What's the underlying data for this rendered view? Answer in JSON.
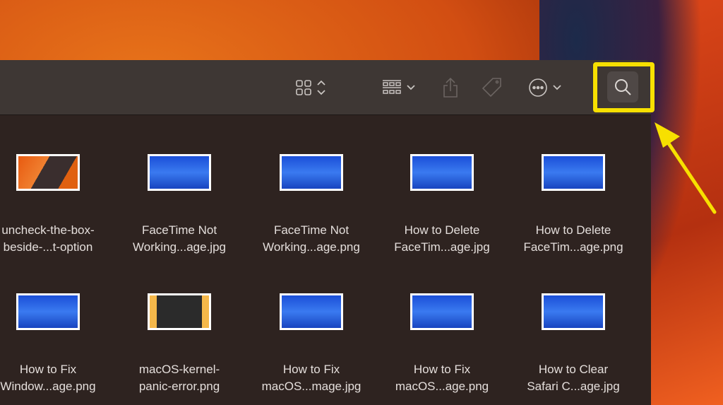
{
  "toolbar": {
    "icons": [
      "grid-view-icon",
      "group-by-icon",
      "share-icon",
      "tag-icon",
      "more-actions-icon",
      "search-icon"
    ]
  },
  "files": [
    {
      "line1": "uncheck-the-box-",
      "line2": "beside-...t-option",
      "thumb": "or"
    },
    {
      "line1": "FaceTime Not",
      "line2": "Working...age.jpg",
      "thumb": "bl"
    },
    {
      "line1": "FaceTime Not",
      "line2": "Working...age.png",
      "thumb": "bl"
    },
    {
      "line1": "How to Delete",
      "line2": "FaceTim...age.jpg",
      "thumb": "bl"
    },
    {
      "line1": "How to Delete",
      "line2": "FaceTim...age.png",
      "thumb": "bl"
    },
    {
      "line1": "How to Fix",
      "line2": "Window...age.png",
      "thumb": "bl"
    },
    {
      "line1": "macOS-kernel-",
      "line2": "panic-error.png",
      "thumb": "ye"
    },
    {
      "line1": "How to Fix",
      "line2": "macOS...mage.jpg",
      "thumb": "bl"
    },
    {
      "line1": "How to Fix",
      "line2": "macOS...age.png",
      "thumb": "bl"
    },
    {
      "line1": "How to Clear",
      "line2": "Safari C...age.jpg",
      "thumb": "bl"
    }
  ],
  "colors": {
    "highlight": "#f7e000"
  }
}
